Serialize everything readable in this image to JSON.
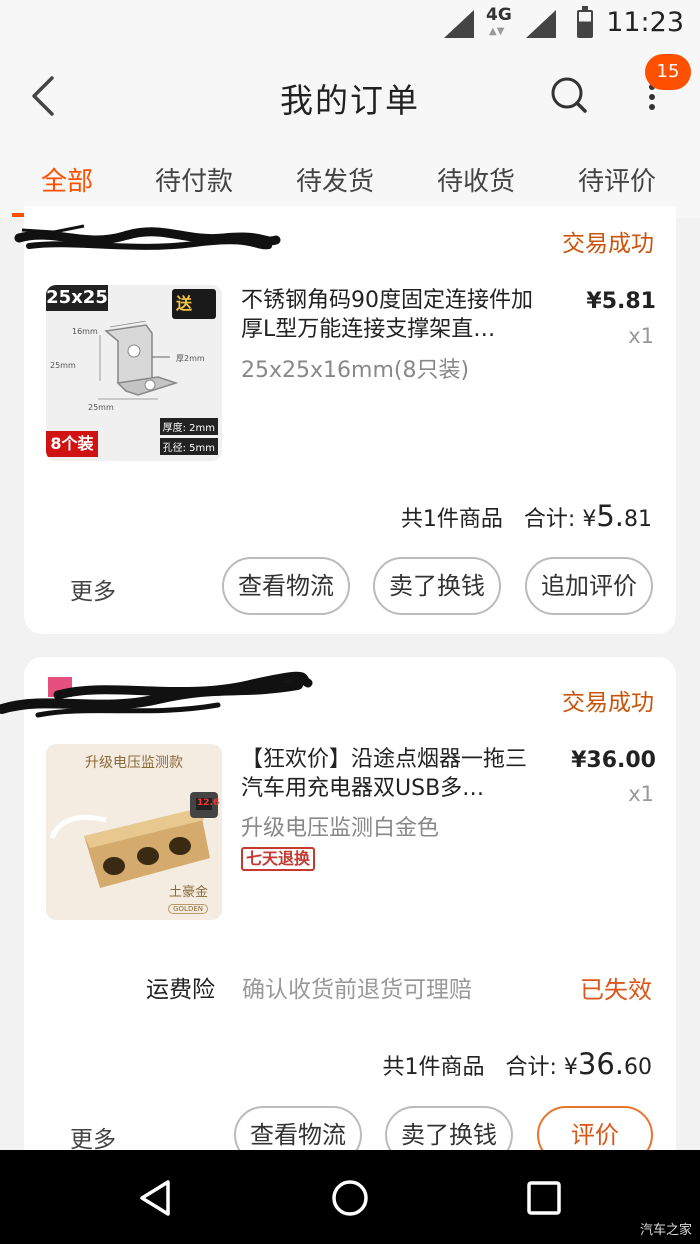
{
  "status_bar": {
    "network": "4G",
    "time": "11:23"
  },
  "header": {
    "title": "我的订单",
    "notification_count": "15"
  },
  "tabs": [
    {
      "label": "全部",
      "active": true
    },
    {
      "label": "待付款"
    },
    {
      "label": "待发货"
    },
    {
      "label": "待收货"
    },
    {
      "label": "待评价"
    }
  ],
  "orders": [
    {
      "status": "交易成功",
      "item": {
        "title": "不锈钢角码90度固定连接件加厚L型万能连接支撑架直…",
        "sku": "25x25x16mm(8只装)",
        "price": "¥5.81",
        "qty": "x1",
        "thumb": {
          "size_label": "25x25",
          "gift_label": "送",
          "count_label": "8个装",
          "dim_width": "25mm",
          "dim_height": "25mm",
          "dim_depth": "16mm",
          "dim_thick": "厚2mm",
          "spec_thickness": "厚度: 2mm",
          "spec_hole": "孔径: 5mm"
        }
      },
      "summary": {
        "count_text": "共1件商品",
        "total_label": "合计:",
        "currency": "¥",
        "total_int": "5.",
        "total_dec": "81"
      },
      "actions": {
        "more": "更多",
        "buttons": [
          "查看物流",
          "卖了换钱",
          "追加评价"
        ]
      }
    },
    {
      "status": "交易成功",
      "item": {
        "title": "【狂欢价】沿途点烟器一拖三汽车用充电器双USB多…",
        "sku": "升级电压监测白金色",
        "price": "¥36.00",
        "qty": "x1",
        "tag": "七天退换",
        "thumb": {
          "header_label": "升级电压监测款",
          "color_label": "土豪金",
          "color_sub": "GOLDEN",
          "voltage": "12.6"
        }
      },
      "insurance": {
        "label": "运费险",
        "desc": "确认收货前退货可理赔",
        "state": "已失效"
      },
      "summary": {
        "count_text": "共1件商品",
        "total_label": "合计:",
        "currency": "¥",
        "total_int": "36.",
        "total_dec": "60"
      },
      "actions": {
        "more": "更多",
        "buttons": [
          "查看物流",
          "卖了换钱",
          "评价"
        ]
      }
    }
  ],
  "watermark": "汽车之家",
  "colors": {
    "accent": "#ff5000",
    "status": "#c9540a"
  }
}
